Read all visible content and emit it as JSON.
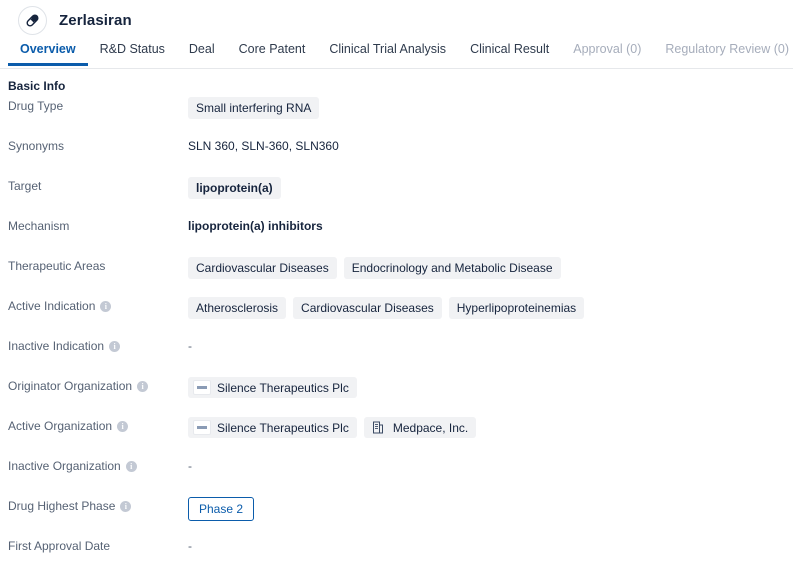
{
  "header": {
    "drug_name": "Zerlasiran",
    "avatar_icon": "pill-capsule-icon"
  },
  "tabs": [
    {
      "label": "Overview",
      "state": "active"
    },
    {
      "label": "R&D Status",
      "state": "normal"
    },
    {
      "label": "Deal",
      "state": "normal"
    },
    {
      "label": "Core Patent",
      "state": "normal"
    },
    {
      "label": "Clinical Trial Analysis",
      "state": "normal"
    },
    {
      "label": "Clinical Result",
      "state": "normal"
    },
    {
      "label": "Approval (0)",
      "state": "disabled"
    },
    {
      "label": "Regulatory Review (0)",
      "state": "disabled"
    }
  ],
  "section": {
    "title": "Basic Info"
  },
  "rows": {
    "drug_type": {
      "label": "Drug Type",
      "chip": "Small interfering RNA"
    },
    "synonyms": {
      "label": "Synonyms",
      "value": "SLN 360,  SLN-360,  SLN360"
    },
    "target": {
      "label": "Target",
      "chip": "lipoprotein(a)"
    },
    "mechanism": {
      "label": "Mechanism",
      "value": "lipoprotein(a) inhibitors"
    },
    "therapeutic_areas": {
      "label": "Therapeutic Areas",
      "chips": [
        "Cardiovascular Diseases",
        "Endocrinology and Metabolic Disease"
      ]
    },
    "active_indication": {
      "label": "Active Indication",
      "has_info": true,
      "chips": [
        "Atherosclerosis",
        "Cardiovascular Diseases",
        "Hyperlipoproteinemias"
      ]
    },
    "inactive_indication": {
      "label": "Inactive Indication",
      "has_info": true,
      "value": "-"
    },
    "originator_organization": {
      "label": "Originator Organization",
      "has_info": true,
      "orgs": [
        {
          "name": "Silence Therapeutics Plc",
          "icon": "company-logo-icon"
        }
      ]
    },
    "active_organization": {
      "label": "Active Organization",
      "has_info": true,
      "orgs": [
        {
          "name": "Silence Therapeutics Plc",
          "icon": "company-logo-icon"
        },
        {
          "name": "Medpace, Inc.",
          "icon": "building-icon"
        }
      ]
    },
    "inactive_organization": {
      "label": "Inactive Organization",
      "has_info": true,
      "value": "-"
    },
    "drug_highest_phase": {
      "label": "Drug Highest Phase",
      "has_info": true,
      "badge": "Phase 2"
    },
    "first_approval_date": {
      "label": "First Approval Date",
      "has_info": false,
      "value": "-"
    }
  },
  "colors": {
    "accent": "#0b5cab",
    "label": "#566274",
    "text": "#16243d",
    "chip_bg": "#f1f2f4",
    "disabled_tab": "#a6adbb"
  }
}
